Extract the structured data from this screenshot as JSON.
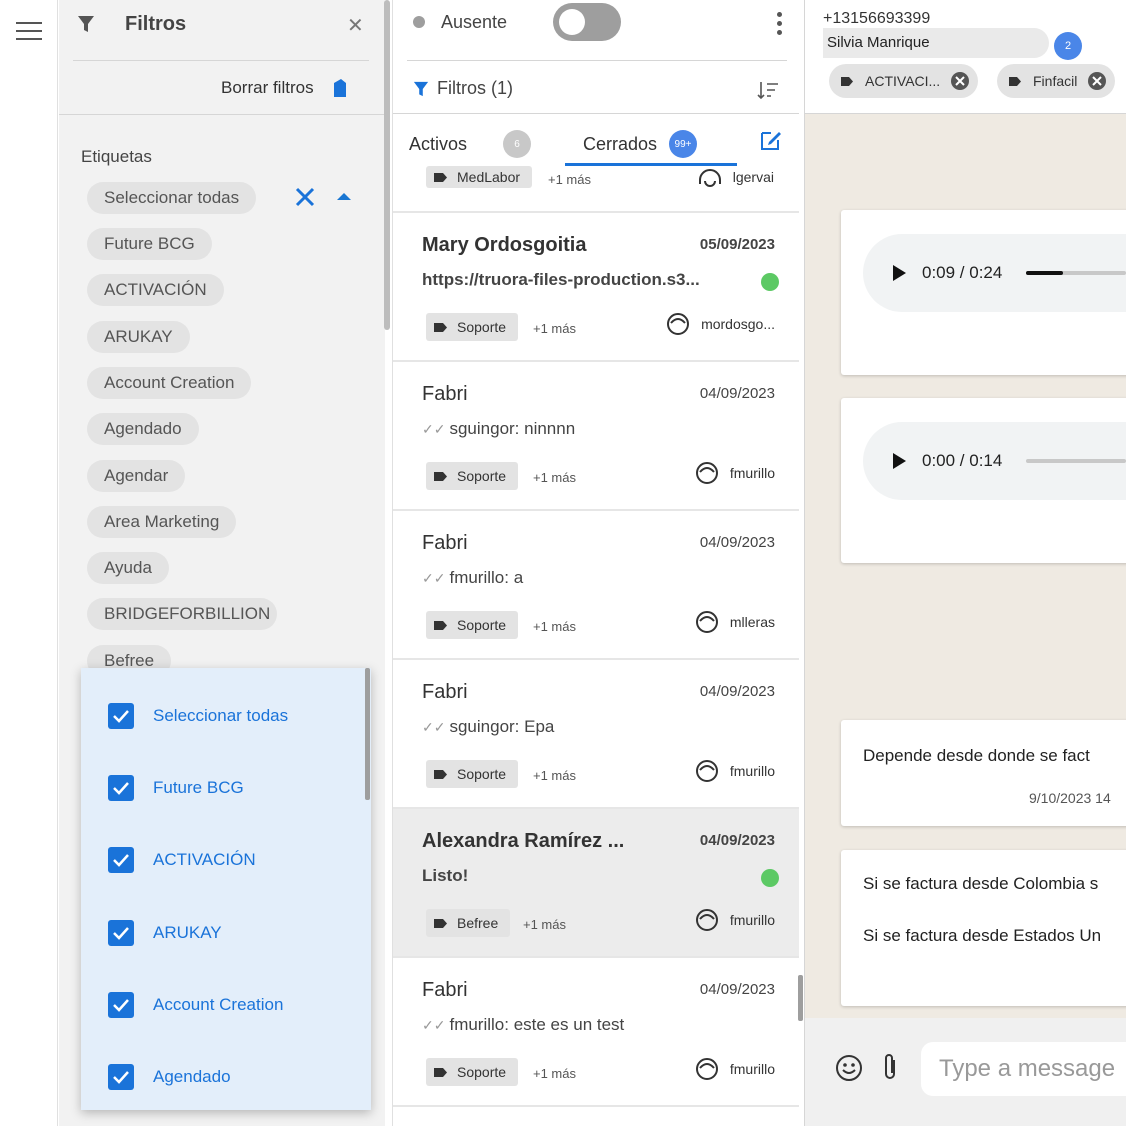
{
  "colors": {
    "accent": "#1a73d9",
    "online": "#5cc964",
    "chip_bg": "#e3e3e3"
  },
  "filters": {
    "title": "Filtros",
    "clear_label": "Borrar filtros",
    "section_label": "Etiquetas",
    "chips": [
      "Seleccionar todas",
      "Future BCG",
      "ACTIVACIÓN",
      "ARUKAY",
      "Account Creation",
      "Agendado",
      "Agendar",
      "Area Marketing",
      "Ayuda",
      "BRIDGEFORBILLION",
      "Befree"
    ],
    "dropdown": [
      "Seleccionar todas",
      "Future BCG",
      "ACTIVACIÓN",
      "ARUKAY",
      "Account Creation",
      "Agendado"
    ]
  },
  "list": {
    "status": "Ausente",
    "filter_label": "Filtros (1)",
    "tabs": [
      {
        "label": "Activos",
        "badge": "6"
      },
      {
        "label": "Cerrados",
        "badge": "99+"
      }
    ],
    "partial_item": {
      "tag": "MedLabor",
      "more": "+1 más",
      "agent": "lgervai"
    },
    "conversations": [
      {
        "name": "Mary Ordosgoitia",
        "date": "05/09/2023",
        "msg": "https://truora-files-production.s3...",
        "tag": "Soporte",
        "more": "+1 más",
        "agent": "mordosgo..."
      },
      {
        "name": "Fabri",
        "date": "04/09/2023",
        "msg": "sguingor: ninnnn",
        "tag": "Soporte",
        "more": "+1 más",
        "agent": "fmurillo"
      },
      {
        "name": "Fabri",
        "date": "04/09/2023",
        "msg": "fmurillo: a",
        "tag": "Soporte",
        "more": "+1 más",
        "agent": "mlleras"
      },
      {
        "name": "Fabri",
        "date": "04/09/2023",
        "msg": "sguingor: Epa",
        "tag": "Soporte",
        "more": "+1 más",
        "agent": "fmurillo"
      },
      {
        "name": "Alexandra Ramírez ...",
        "date": "04/09/2023",
        "msg": "Listo!",
        "tag": "Befree",
        "more": "+1 más",
        "agent": "fmurillo"
      },
      {
        "name": "Fabri",
        "date": "04/09/2023",
        "msg": "fmurillo: este es un test",
        "tag": "Soporte",
        "more": "+1 más",
        "agent": "fmurillo"
      }
    ]
  },
  "chat": {
    "phone": "+13156693399",
    "contact_name": "Silvia Manrique",
    "contact_badge": "2",
    "header_tags": [
      "ACTIVACI...",
      "Finfacil"
    ],
    "audio1": {
      "time": "0:09 / 0:24",
      "progress": 0.37
    },
    "audio2": {
      "time": "0:00 / 0:14",
      "progress": 0
    },
    "message1": {
      "text": "Depende desde donde se fact",
      "time": "9/10/2023 14"
    },
    "message2": {
      "line1": "Si se factura desde Colombia s",
      "line2": "Si se factura desde Estados Un"
    },
    "input_placeholder": "Type a message"
  }
}
